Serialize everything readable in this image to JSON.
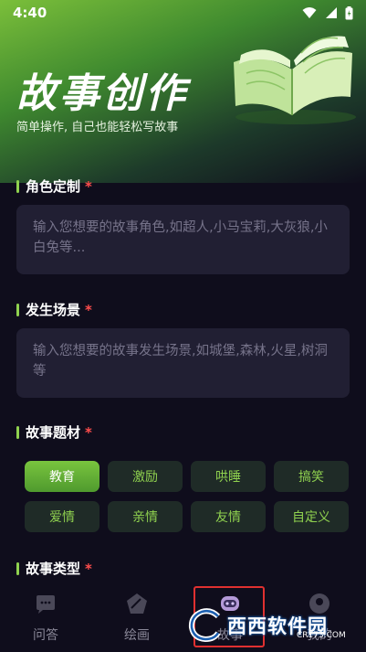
{
  "status": {
    "time": "4:40"
  },
  "hero": {
    "title": "故事创作",
    "subtitle": "简单操作, 自己也能轻松写故事"
  },
  "sections": {
    "character": {
      "title": "角色定制",
      "required_mark": "*",
      "placeholder": "输入您想要的故事角色,如超人,小马宝莉,大灰狼,小白兔等..."
    },
    "scene": {
      "title": "发生场景",
      "required_mark": "*",
      "placeholder": "输入您想要的故事发生场景,如城堡,森林,火星,树洞等"
    },
    "theme": {
      "title": "故事题材",
      "required_mark": "*",
      "options": [
        "教育",
        "激励",
        "哄睡",
        "搞笑",
        "爱情",
        "亲情",
        "友情",
        "自定义"
      ],
      "selected": "教育"
    },
    "type": {
      "title": "故事类型",
      "required_mark": "*"
    }
  },
  "tabbar": {
    "tabs": [
      {
        "label": "问答",
        "icon": "chat-bubble-icon"
      },
      {
        "label": "绘画",
        "icon": "palette-icon"
      },
      {
        "label": "故事",
        "icon": "robot-story-icon"
      },
      {
        "label": "我的",
        "icon": "profile-icon"
      }
    ],
    "active": "故事"
  },
  "watermark": {
    "text": "西西软件园",
    "sub": "CR173.COM"
  },
  "colors": {
    "accent": "#8fd14f",
    "background": "#0f0d1c",
    "card": "#211f33",
    "required": "#ff4d4d",
    "highlight_box": "#e03030"
  }
}
